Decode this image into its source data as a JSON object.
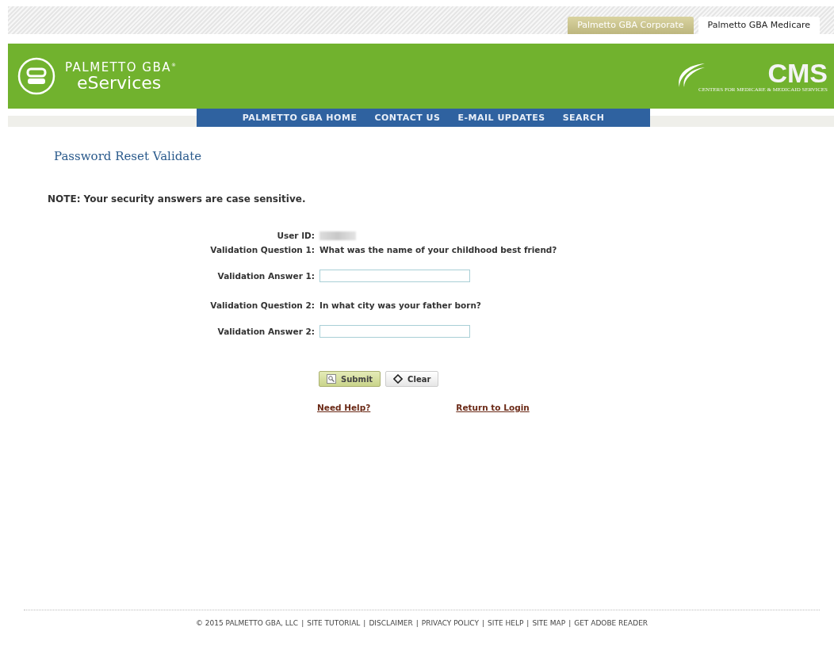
{
  "site_tabs": [
    {
      "label": "Palmetto GBA Corporate",
      "selected": false
    },
    {
      "label": "Palmetto GBA Medicare",
      "selected": true
    }
  ],
  "logo": {
    "brand": "PALMETTO GBA",
    "registered": "®",
    "product": "eServices"
  },
  "cms_logo": {
    "letters": "CMS",
    "tagline": "CENTERS FOR MEDICARE & MEDICAID SERVICES"
  },
  "nav": [
    "PALMETTO GBA HOME",
    "CONTACT US",
    "E-MAIL UPDATES",
    "SEARCH"
  ],
  "page_title": "Password Reset Validate",
  "note": "NOTE: Your security answers are case sensitive.",
  "form": [
    {
      "kind": "redacted",
      "label": "User ID:"
    },
    {
      "kind": "text",
      "label": "Validation Question 1:",
      "value": "What was the name of your childhood best friend?"
    },
    {
      "kind": "input",
      "label": "Validation Answer 1:"
    },
    {
      "kind": "text",
      "label": "Validation Question 2:",
      "value": "In what city was your father born?"
    },
    {
      "kind": "input",
      "label": "Validation Answer 2:"
    }
  ],
  "buttons": [
    {
      "kind": "submit",
      "label": "Submit"
    },
    {
      "kind": "clear",
      "label": "Clear"
    }
  ],
  "links": [
    "Need Help?",
    "Return to Login"
  ],
  "footer": {
    "copyright": "© 2015 PALMETTO GBA, LLC",
    "separator": "|",
    "links": [
      "SITE TUTORIAL",
      "DISCLAIMER",
      "PRIVACY POLICY",
      "SITE HELP",
      "SITE MAP",
      "GET ADOBE READER"
    ]
  }
}
